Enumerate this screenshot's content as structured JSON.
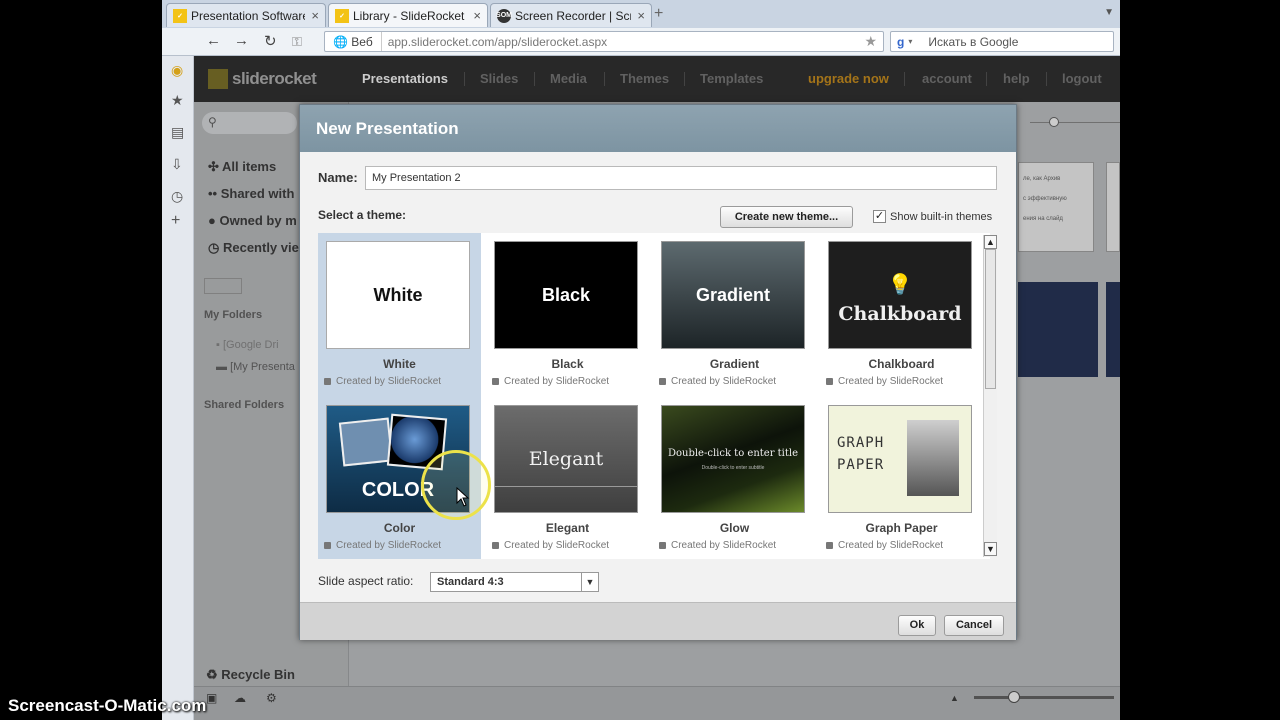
{
  "browser": {
    "tabs": [
      {
        "label": "Presentation Software |...",
        "icon": "slide-rocket-icon"
      },
      {
        "label": "Library - SlideRocket",
        "icon": "slide-rocket-icon"
      },
      {
        "label": "Screen Recorder | Scree...",
        "icon": "som-icon",
        "icon_text": "SOM"
      }
    ],
    "url_prefix": "Веб",
    "url": "app.sliderocket.com/app/sliderocket.aspx",
    "search_placeholder": "Искать в Google",
    "search_engine_glyph": "g"
  },
  "app": {
    "logo_text": "sliderocket",
    "nav": [
      "Presentations",
      "Slides",
      "Media",
      "Themes",
      "Templates"
    ],
    "nav_active": "Presentations",
    "upgrade": "upgrade now",
    "account": "account",
    "help": "help",
    "logout": "logout",
    "left_panel": {
      "items": [
        "All items",
        "Shared with",
        "Owned by m",
        "Recently vie"
      ],
      "my_folders_label": "My Folders",
      "folders": [
        "[Google Dri",
        "[My Presenta"
      ],
      "shared_folders_label": "Shared Folders",
      "recycle_bin": "Recycle Bin"
    },
    "bg_thumb_texts": [
      "ле, как Архив",
      "с эффективную",
      "ения на слайд"
    ]
  },
  "dialog": {
    "title": "New Presentation",
    "name_label": "Name:",
    "name_value": "My Presentation 2",
    "theme_label": "Select a theme:",
    "create_theme_button": "Create new theme...",
    "show_builtin_label": "Show built-in themes",
    "show_builtin_checked": true,
    "themes": [
      {
        "name": "White",
        "thumb_text": "White",
        "created_by": "Created by SlideRocket",
        "selected": true
      },
      {
        "name": "Black",
        "thumb_text": "Black",
        "created_by": "Created by SlideRocket",
        "selected": false
      },
      {
        "name": "Gradient",
        "thumb_text": "Gradient",
        "created_by": "Created by SlideRocket",
        "selected": false
      },
      {
        "name": "Chalkboard",
        "thumb_text": "Chalkboard",
        "created_by": "Created by SlideRocket",
        "selected": false
      },
      {
        "name": "Color",
        "thumb_text": "COLOR",
        "created_by": "Created by SlideRocket",
        "selected": true
      },
      {
        "name": "Elegant",
        "thumb_text": "Elegant",
        "created_by": "Created by SlideRocket",
        "selected": false
      },
      {
        "name": "Glow",
        "thumb_text": "Double-click to enter title",
        "thumb_subtext": "Double-click to enter subtitle",
        "created_by": "Created by SlideRocket",
        "selected": false
      },
      {
        "name": "Graph Paper",
        "thumb_text": "GRAPH PAPER",
        "created_by": "Created by SlideRocket",
        "selected": false
      }
    ],
    "aspect_label": "Slide aspect ratio:",
    "aspect_value": "Standard 4:3",
    "ok_button": "Ok",
    "cancel_button": "Cancel"
  },
  "watermark": "Screencast-O-Matic.com"
}
